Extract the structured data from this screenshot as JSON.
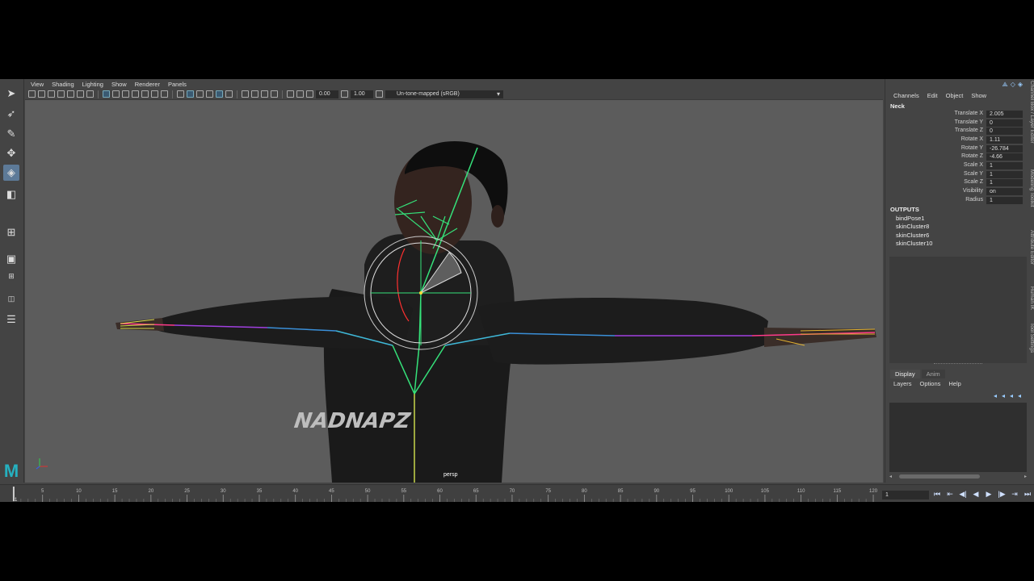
{
  "viewport": {
    "menu": [
      "View",
      "Shading",
      "Lighting",
      "Show",
      "Renderer",
      "Panels"
    ],
    "exposure_value": "0.00",
    "gamma_value": "1.00",
    "color_space": "Un-tone-mapped (sRGB)",
    "camera_label": "persp",
    "hoodie_text": "NADNAPZ"
  },
  "channel_box": {
    "menu": [
      "Channels",
      "Edit",
      "Object",
      "Show"
    ],
    "node_name": "Neck",
    "attributes": [
      {
        "label": "Translate X",
        "value": "2.005"
      },
      {
        "label": "Translate Y",
        "value": "0"
      },
      {
        "label": "Translate Z",
        "value": "0"
      },
      {
        "label": "Rotate X",
        "value": "1.11"
      },
      {
        "label": "Rotate Y",
        "value": "-26.784"
      },
      {
        "label": "Rotate Z",
        "value": "-4.66"
      },
      {
        "label": "Scale X",
        "value": "1"
      },
      {
        "label": "Scale Y",
        "value": "1"
      },
      {
        "label": "Scale Z",
        "value": "1"
      },
      {
        "label": "Visibility",
        "value": "on"
      },
      {
        "label": "Radius",
        "value": "1"
      }
    ],
    "outputs_title": "OUTPUTS",
    "outputs": [
      "bindPose1",
      "skinCluster8",
      "skinCluster6",
      "skinCluster10"
    ]
  },
  "layer_editor": {
    "tabs": [
      "Display",
      "Anim"
    ],
    "active_tab": "Display",
    "menu": [
      "Layers",
      "Options",
      "Help"
    ]
  },
  "side_tabs": [
    "Channel Box / Layer Editor",
    "Modeling Toolkit",
    "Attribute Editor",
    "Human IK",
    "Tool Settings"
  ],
  "timeline": {
    "current_frame": "1",
    "start_marker": "1",
    "ticks": [
      "5",
      "10",
      "15",
      "20",
      "25",
      "30",
      "35",
      "40",
      "45",
      "50",
      "55",
      "60",
      "65",
      "70",
      "75",
      "80",
      "85",
      "90",
      "95",
      "100",
      "105",
      "110",
      "115",
      "120"
    ],
    "tick_values": [
      5,
      10,
      15,
      20,
      25,
      30,
      35,
      40,
      45,
      50,
      55,
      60,
      65,
      70,
      75,
      80,
      85,
      90,
      95,
      100,
      105,
      110,
      115,
      120
    ]
  },
  "colors": {
    "ui_bg": "#444444",
    "viewport_bg": "#5c5c5c",
    "joint_green": "#35e27a",
    "maya_logo": "#25b1c0"
  },
  "toolbox_icons": [
    "select-tool-icon",
    "lasso-tool-icon",
    "paint-select-icon",
    "move-tool-icon",
    "rotate-tool-icon",
    "scale-tool-icon",
    "last-tool-icon",
    "single-view-icon",
    "two-view-icon",
    "outliner-icon"
  ]
}
